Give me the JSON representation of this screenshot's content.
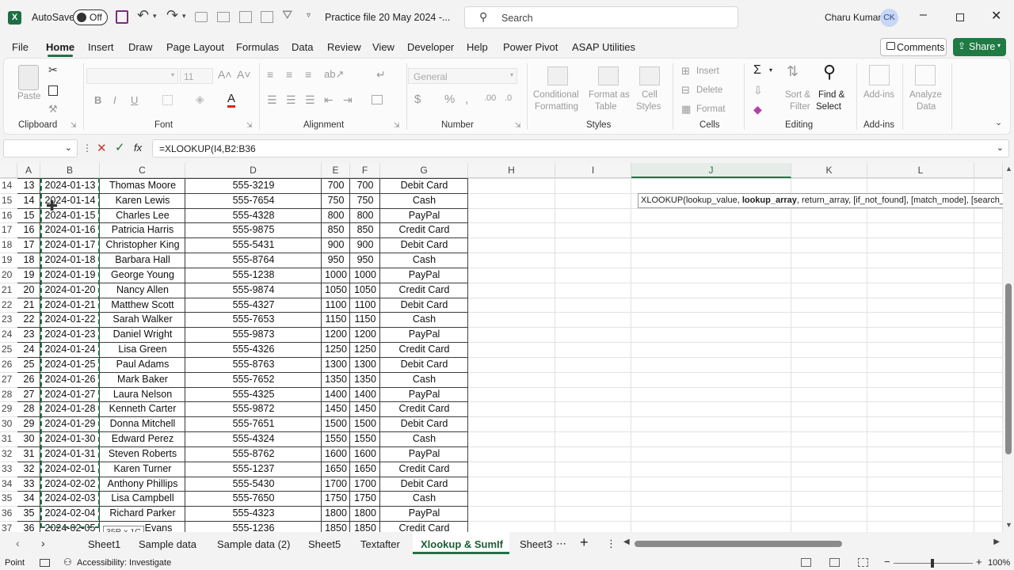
{
  "titlebar": {
    "autosave_label": "AutoSave",
    "autosave_state": "Off",
    "filename": "Practice file 20 May 2024  -...",
    "search_placeholder": "Search",
    "user_name": "Charu Kumar",
    "user_initials": "CK"
  },
  "ribbon_tabs": [
    "File",
    "Home",
    "Insert",
    "Draw",
    "Page Layout",
    "Formulas",
    "Data",
    "Review",
    "View",
    "Developer",
    "Help",
    "Power Pivot",
    "ASAP Utilities"
  ],
  "active_tab": "Home",
  "comments_label": "Comments",
  "share_label": "Share",
  "ribbon": {
    "clipboard": {
      "paste": "Paste",
      "label": "Clipboard"
    },
    "font": {
      "label": "Font",
      "size": "11",
      "bold": "B",
      "italic": "I",
      "underline": "U"
    },
    "alignment": {
      "label": "Alignment"
    },
    "number": {
      "label": "Number",
      "format": "General",
      "currency": "$",
      "percent": "%"
    },
    "styles": {
      "label": "Styles",
      "conditional": "Conditional",
      "conditional2": "Formatting",
      "format_as": "Format as",
      "format_as2": "Table",
      "cell": "Cell",
      "cell2": "Styles"
    },
    "cells": {
      "label": "Cells",
      "insert": "Insert",
      "delete": "Delete",
      "format": "Format"
    },
    "editing": {
      "label": "Editing",
      "sort": "Sort &",
      "sort2": "Filter",
      "find": "Find &",
      "find2": "Select"
    },
    "addins": {
      "label": "Add-ins",
      "addins": "Add-ins",
      "analyze": "Analyze",
      "analyze2": "Data"
    }
  },
  "formula": {
    "name_box": "",
    "fx": "fx",
    "text": "=XLOOKUP(I4,B2:B36"
  },
  "tooltip": {
    "fn": "XLOOKUP(",
    "a1": "lookup_value, ",
    "a2": "lookup_array",
    "rest": ", return_array, [if_not_found], [match_mode], [search_m"
  },
  "columns": [
    "A",
    "B",
    "C",
    "D",
    "E",
    "F",
    "G",
    "H",
    "I",
    "J",
    "K",
    "L"
  ],
  "rows": [
    {
      "r": "14",
      "a": "13",
      "b": "2024-01-13",
      "c": "Thomas Moore",
      "d": "555-3219",
      "e": "700",
      "f": "700",
      "g": "Debit Card"
    },
    {
      "r": "15",
      "a": "14",
      "b": "2024-01-14",
      "c": "Karen Lewis",
      "d": "555-7654",
      "e": "750",
      "f": "750",
      "g": "Cash"
    },
    {
      "r": "16",
      "a": "15",
      "b": "2024-01-15",
      "c": "Charles Lee",
      "d": "555-4328",
      "e": "800",
      "f": "800",
      "g": "PayPal"
    },
    {
      "r": "17",
      "a": "16",
      "b": "2024-01-16",
      "c": "Patricia Harris",
      "d": "555-9875",
      "e": "850",
      "f": "850",
      "g": "Credit Card"
    },
    {
      "r": "18",
      "a": "17",
      "b": "2024-01-17",
      "c": "Christopher King",
      "d": "555-5431",
      "e": "900",
      "f": "900",
      "g": "Debit Card"
    },
    {
      "r": "19",
      "a": "18",
      "b": "2024-01-18",
      "c": "Barbara Hall",
      "d": "555-8764",
      "e": "950",
      "f": "950",
      "g": "Cash"
    },
    {
      "r": "20",
      "a": "19",
      "b": "2024-01-19",
      "c": "George Young",
      "d": "555-1238",
      "e": "1000",
      "f": "1000",
      "g": "PayPal"
    },
    {
      "r": "21",
      "a": "20",
      "b": "2024-01-20",
      "c": "Nancy Allen",
      "d": "555-9874",
      "e": "1050",
      "f": "1050",
      "g": "Credit Card"
    },
    {
      "r": "22",
      "a": "21",
      "b": "2024-01-21",
      "c": "Matthew Scott",
      "d": "555-4327",
      "e": "1100",
      "f": "1100",
      "g": "Debit Card"
    },
    {
      "r": "23",
      "a": "22",
      "b": "2024-01-22",
      "c": "Sarah Walker",
      "d": "555-7653",
      "e": "1150",
      "f": "1150",
      "g": "Cash"
    },
    {
      "r": "24",
      "a": "23",
      "b": "2024-01-23",
      "c": "Daniel Wright",
      "d": "555-9873",
      "e": "1200",
      "f": "1200",
      "g": "PayPal"
    },
    {
      "r": "25",
      "a": "24",
      "b": "2024-01-24",
      "c": "Lisa Green",
      "d": "555-4326",
      "e": "1250",
      "f": "1250",
      "g": "Credit Card"
    },
    {
      "r": "26",
      "a": "25",
      "b": "2024-01-25",
      "c": "Paul Adams",
      "d": "555-8763",
      "e": "1300",
      "f": "1300",
      "g": "Debit Card"
    },
    {
      "r": "27",
      "a": "26",
      "b": "2024-01-26",
      "c": "Mark Baker",
      "d": "555-7652",
      "e": "1350",
      "f": "1350",
      "g": "Cash"
    },
    {
      "r": "28",
      "a": "27",
      "b": "2024-01-27",
      "c": "Laura Nelson",
      "d": "555-4325",
      "e": "1400",
      "f": "1400",
      "g": "PayPal"
    },
    {
      "r": "29",
      "a": "28",
      "b": "2024-01-28",
      "c": "Kenneth Carter",
      "d": "555-9872",
      "e": "1450",
      "f": "1450",
      "g": "Credit Card"
    },
    {
      "r": "30",
      "a": "29",
      "b": "2024-01-29",
      "c": "Donna Mitchell",
      "d": "555-7651",
      "e": "1500",
      "f": "1500",
      "g": "Debit Card"
    },
    {
      "r": "31",
      "a": "30",
      "b": "2024-01-30",
      "c": "Edward Perez",
      "d": "555-4324",
      "e": "1550",
      "f": "1550",
      "g": "Cash"
    },
    {
      "r": "32",
      "a": "31",
      "b": "2024-01-31",
      "c": "Steven Roberts",
      "d": "555-8762",
      "e": "1600",
      "f": "1600",
      "g": "PayPal"
    },
    {
      "r": "33",
      "a": "32",
      "b": "2024-02-01",
      "c": "Karen Turner",
      "d": "555-1237",
      "e": "1650",
      "f": "1650",
      "g": "Credit Card"
    },
    {
      "r": "34",
      "a": "33",
      "b": "2024-02-02",
      "c": "Anthony Phillips",
      "d": "555-5430",
      "e": "1700",
      "f": "1700",
      "g": "Debit Card"
    },
    {
      "r": "35",
      "a": "34",
      "b": "2024-02-03",
      "c": "Lisa Campbell",
      "d": "555-7650",
      "e": "1750",
      "f": "1750",
      "g": "Cash"
    },
    {
      "r": "36",
      "a": "35",
      "b": "2024-02-04",
      "c": "Richard Parker",
      "d": "555-4323",
      "e": "1800",
      "f": "1800",
      "g": "PayPal"
    },
    {
      "r": "37",
      "a": "36",
      "b": "2024-02-05",
      "c": "Evans",
      "d": "555-1236",
      "e": "1850",
      "f": "1850",
      "g": "Credit Card"
    }
  ],
  "range_tip": "35R x 1C",
  "sheets": [
    "Sheet1",
    "Sample data",
    "Sample data (2)",
    "Sheet5",
    "Textafter",
    "Xlookup & SumIf",
    "Sheet3"
  ],
  "active_sheet": "Xlookup & SumIf",
  "status": {
    "mode": "Point",
    "accessibility": "Accessibility: Investigate",
    "zoom": "100%"
  },
  "colors": {
    "accent": "#217346",
    "share": "#1f7a43"
  }
}
